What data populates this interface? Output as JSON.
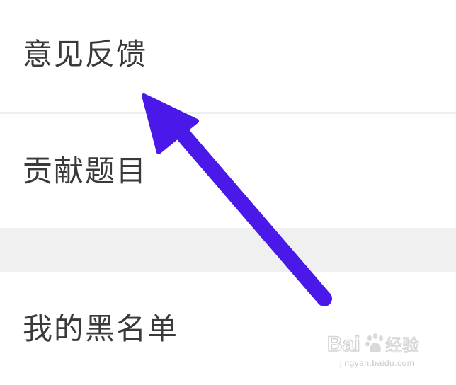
{
  "menu": {
    "items": [
      {
        "label": "意见反馈"
      },
      {
        "label": "贡献题目"
      },
      {
        "label": "我的黑名单"
      }
    ]
  },
  "annotation": {
    "arrow_color": "#4a18e8",
    "arrow_icon": "arrow-up-left-icon"
  },
  "watermark": {
    "brand": "Baidu经验",
    "url": "jingyan.baidu.com"
  },
  "colors": {
    "background": "#ffffff",
    "text": "#3a3a3a",
    "divider": "#eeeeee",
    "section_gap": "#f0f0f0"
  }
}
